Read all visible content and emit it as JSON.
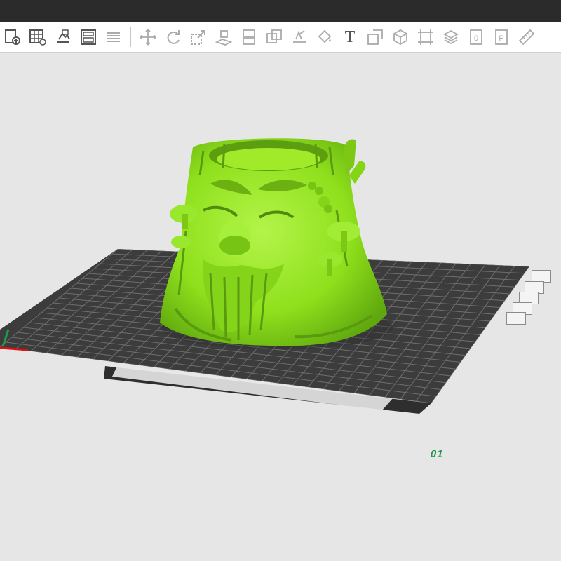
{
  "toolbar": {
    "icons": [
      "add-file-icon",
      "grid-add-icon",
      "import-model-icon",
      "layout-icon",
      "layers-icon",
      "move-icon",
      "rotate-icon",
      "scale-icon",
      "place-on-face-icon",
      "cut-icon",
      "boolean-icon",
      "support-paint-icon",
      "color-paint-icon",
      "text-tool-icon",
      "measure-icon",
      "box-view-icon",
      "fit-view-icon",
      "slice-view-icon",
      "copy-plate-icon",
      "plate-p-icon",
      "ruler-icon"
    ],
    "text_tool_label": "T"
  },
  "plate": {
    "label": "01"
  },
  "colors": {
    "model": "#8fe01c",
    "bed": "#3c3c3c",
    "grid": "#6e6e6e",
    "accent": "#1e9a4a"
  }
}
